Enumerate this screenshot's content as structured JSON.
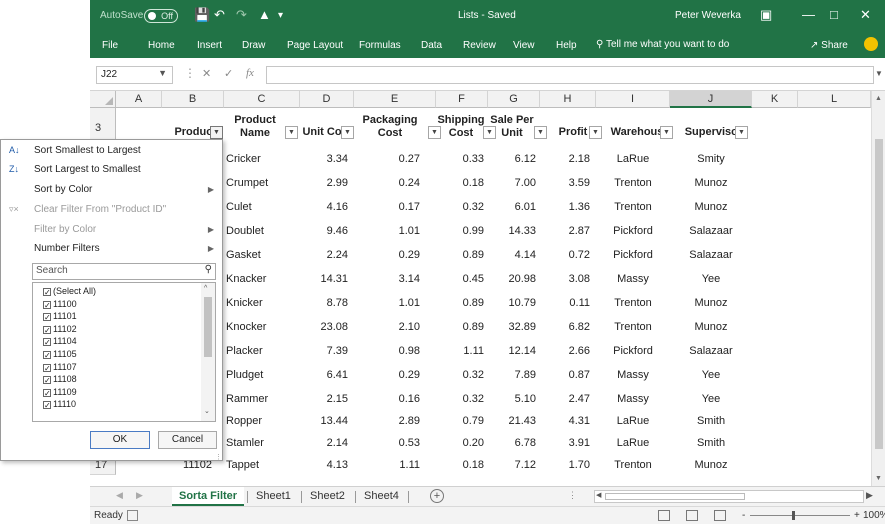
{
  "titlebar": {
    "autosave": "AutoSave",
    "autosave_state": "Off",
    "doc_title": "Lists - Saved",
    "user": "Peter Weverka"
  },
  "ribbon": {
    "tabs": [
      "File",
      "Home",
      "Insert",
      "Draw",
      "Page Layout",
      "Formulas",
      "Data",
      "Review",
      "View",
      "Help"
    ],
    "tell_me": "Tell me what you want to do",
    "share": "Share"
  },
  "formula": {
    "name_box": "J22",
    "fx": "fx",
    "value": ""
  },
  "columns": [
    "A",
    "B",
    "C",
    "D",
    "E",
    "F",
    "G",
    "H",
    "I",
    "J",
    "K",
    "L"
  ],
  "header_row": {
    "row_number": "3",
    "cells": [
      "Product ",
      "Product Name",
      "Unit Co",
      "Packaging Cost",
      "Shipping Cost",
      "Sale Per Unit",
      "Profit",
      "Warehous",
      "Supervisc"
    ]
  },
  "rows": [
    {
      "product_name": "Cricker",
      "unit_cost": "3.34",
      "packaging": "0.27",
      "shipping": "0.33",
      "sale": "6.12",
      "profit": "2.18",
      "warehouse": "LaRue",
      "supervisor": "Smity"
    },
    {
      "product_name": "Crumpet",
      "unit_cost": "2.99",
      "packaging": "0.24",
      "shipping": "0.18",
      "sale": "7.00",
      "profit": "3.59",
      "warehouse": "Trenton",
      "supervisor": "Munoz"
    },
    {
      "product_name": "Culet",
      "unit_cost": "4.16",
      "packaging": "0.17",
      "shipping": "0.32",
      "sale": "6.01",
      "profit": "1.36",
      "warehouse": "Trenton",
      "supervisor": "Munoz"
    },
    {
      "product_name": "Doublet",
      "unit_cost": "9.46",
      "packaging": "1.01",
      "shipping": "0.99",
      "sale": "14.33",
      "profit": "2.87",
      "warehouse": "Pickford",
      "supervisor": "Salazaar"
    },
    {
      "product_name": "Gasket",
      "unit_cost": "2.24",
      "packaging": "0.29",
      "shipping": "0.89",
      "sale": "4.14",
      "profit": "0.72",
      "warehouse": "Pickford",
      "supervisor": "Salazaar"
    },
    {
      "product_name": "Knacker",
      "unit_cost": "14.31",
      "packaging": "3.14",
      "shipping": "0.45",
      "sale": "20.98",
      "profit": "3.08",
      "warehouse": "Massy",
      "supervisor": "Yee"
    },
    {
      "product_name": "Knicker",
      "unit_cost": "8.78",
      "packaging": "1.01",
      "shipping": "0.89",
      "sale": "10.79",
      "profit": "0.11",
      "warehouse": "Trenton",
      "supervisor": "Munoz"
    },
    {
      "product_name": "Knocker",
      "unit_cost": "23.08",
      "packaging": "2.10",
      "shipping": "0.89",
      "sale": "32.89",
      "profit": "6.82",
      "warehouse": "Trenton",
      "supervisor": "Munoz"
    },
    {
      "product_name": "Placker",
      "unit_cost": "7.39",
      "packaging": "0.98",
      "shipping": "1.11",
      "sale": "12.14",
      "profit": "2.66",
      "warehouse": "Pickford",
      "supervisor": "Salazaar"
    },
    {
      "product_name": "Pludget",
      "unit_cost": "6.41",
      "packaging": "0.29",
      "shipping": "0.32",
      "sale": "7.89",
      "profit": "0.87",
      "warehouse": "Massy",
      "supervisor": "Yee"
    },
    {
      "product_name": "Rammer",
      "unit_cost": "2.15",
      "packaging": "0.16",
      "shipping": "0.32",
      "sale": "5.10",
      "profit": "2.47",
      "warehouse": "Massy",
      "supervisor": "Yee"
    },
    {
      "product_name": "Ropper",
      "unit_cost": "13.44",
      "packaging": "2.89",
      "shipping": "0.79",
      "sale": "21.43",
      "profit": "4.31",
      "warehouse": "LaRue",
      "supervisor": "Smith"
    },
    {
      "product_name": "Stamler",
      "unit_cost": "2.14",
      "packaging": "0.53",
      "shipping": "0.20",
      "sale": "6.78",
      "profit": "3.91",
      "warehouse": "LaRue",
      "supervisor": "Smith"
    },
    {
      "row_number": "17",
      "product_id": "11102",
      "product_name": "Tappet",
      "unit_cost": "4.13",
      "packaging": "1.11",
      "shipping": "0.18",
      "sale": "7.12",
      "profit": "1.70",
      "warehouse": "Trenton",
      "supervisor": "Munoz"
    }
  ],
  "filter_menu": {
    "items": [
      {
        "label": "Sort Smallest to Largest",
        "icon": "sort-ascending-icon",
        "enabled": true
      },
      {
        "label": "Sort Largest to Smallest",
        "icon": "sort-descending-icon",
        "enabled": true
      },
      {
        "label": "Sort by Color",
        "icon": "",
        "enabled": true,
        "submenu": true
      },
      {
        "label": "Clear Filter From \"Product ID\"",
        "icon": "clear-filter-icon",
        "enabled": false
      },
      {
        "label": "Filter by Color",
        "icon": "",
        "enabled": false,
        "submenu": true
      },
      {
        "label": "Number Filters",
        "icon": "",
        "enabled": true,
        "submenu": true
      }
    ],
    "search_placeholder": "Search",
    "checklist": [
      "(Select All)",
      "11100",
      "11101",
      "11102",
      "11104",
      "11105",
      "11107",
      "11108",
      "11109",
      "11110"
    ],
    "ok": "OK",
    "cancel": "Cancel"
  },
  "sheets": {
    "tabs": [
      "Sorta Filter",
      "Sheet1",
      "Sheet2",
      "Sheet4"
    ],
    "active": "Sorta Filter"
  },
  "status": {
    "ready": "Ready",
    "zoom": "100%",
    "minus": "-",
    "plus": "+"
  },
  "colors": {
    "excel_green": "#217346"
  }
}
